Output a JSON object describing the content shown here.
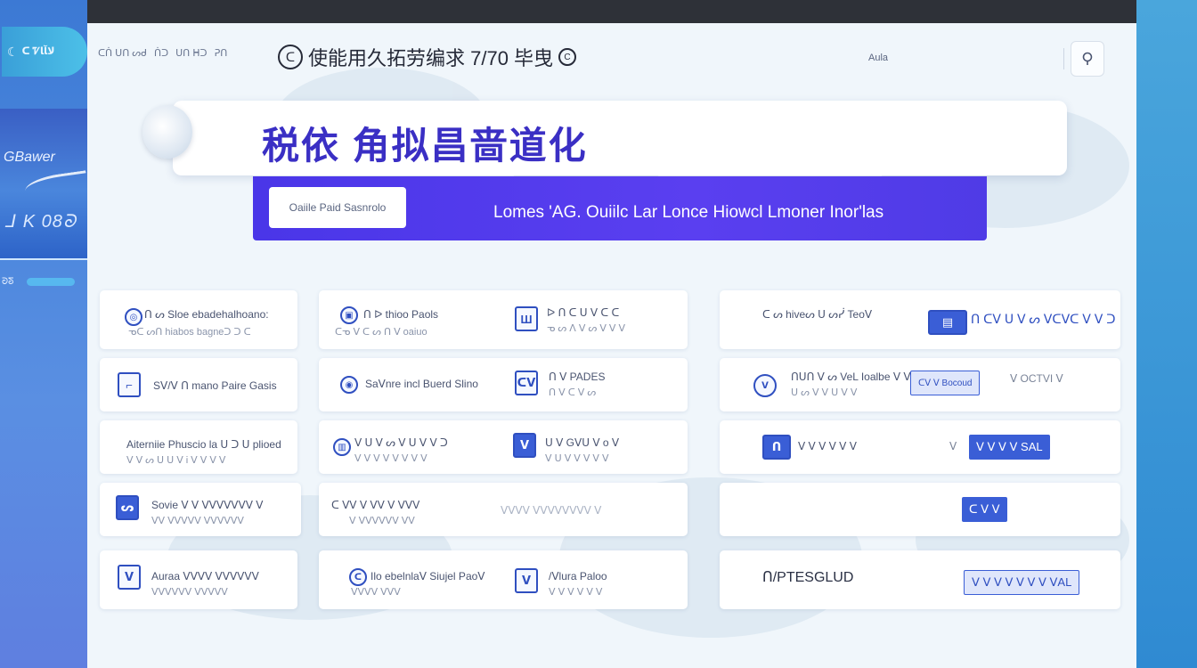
{
  "window": {
    "rail_logo_text": "ᑕ Ꮴﻻﺂﺎ",
    "rail_brand": "GBawer",
    "rail_metric": "ᒧ K 08ᘐ",
    "rail_tag": "ᘐᘕ",
    "user_label": "Aula"
  },
  "header": {
    "nav": [
      "ᑕᑏ ᑌᑎ ᔕᑯ",
      "ᑏᑐ",
      "ᑌᑎ ᕼᑐ",
      "ᕈᑎ"
    ],
    "brand_mark": "ᑕ",
    "brand_text": "使能用久拓劳编求 7/70 毕曳",
    "brand_end": "C"
  },
  "hero": {
    "title": "税依 角拟昌啬道化"
  },
  "banner": {
    "button_label": "Oaiile Paid Sasnrolo",
    "text": "Lomes  'AG. Ouiilc Lar Lonce  Hiowcl Lmoner Inor'las"
  },
  "cards": [
    {
      "icon": "◎",
      "line1": "ᑎ ᔕ Sloe ebadehalhoano:",
      "line2": "ᓀᑕ ᔕᑎ hiabos bagneᑐ ᑐ ᑕ"
    },
    {
      "icon": "▣",
      "line1": "ᑎ ᐅ thioo Paols",
      "line2": "ᑕᓀ ᐯ ᑕ ᔕ ᑎ ᐯ oaiuo"
    },
    {
      "icon": "Ш",
      "line1": "ᐅ ᑎ ᑕ ᑌ ᐯ ᑕ ᑕ",
      "line2": "ᓀ ᔕ ᐱ ᐯ ᔕ ᐯ ᐯ ᐯ"
    },
    {
      "icon": "O",
      "line1": "ᑕ ᔕ hiveᔕ ᑌ ᔕᓰ Teoᐯ",
      "line2": ""
    },
    {
      "icon": "▤",
      "line1": "ᑎ ᑕᐯ ᑌ ᐯ ᔕ ᐯᑕᐯᑕ ᐯ ᐯ ᑐ",
      "line2": ""
    },
    {
      "icon": "⌐",
      "line1": "Sᐯ/ᐯ ᑎ mano Paire Gasis",
      "line2": ""
    },
    {
      "icon": "◉",
      "line1": "Saᐯnre incl Buerd Slino",
      "line2": ""
    },
    {
      "icon": "ᑕᐯ",
      "line1": "ᑎ ᐯ PADES",
      "line2": "ᑎ ᐯ ᑕ ᐯ ᔕ"
    },
    {
      "icon": "ᐯ",
      "line1": "ᑎᑌᑎ ᐯ ᔕ VeL Ioalbe ᐯ ᐯ",
      "line2": "ᑌ ᔕ ᐯ ᐯ ᑌ ᐯ ᐯ"
    },
    {
      "badge": "ᑕᐯ ᐯ Bocoud",
      "side": "ᐯ OCTVI ᐯ"
    },
    {
      "icon": "",
      "line1": "Aiterniie Phuscio la ᑌ ᑐ ᑌ plioed",
      "line2": "ᐯ ᐯ ᔕ ᑌ ᑌ ᐯ Ꭵ ᐯ ᐯ ᐯ ᐯ"
    },
    {
      "icon": "▥",
      "line1": "ᐯ ᑌ ᐯ ᔕ ᐯ ᑌ ᐯ ᐯ ᑐ",
      "line2": "ᐯ ᐯ ᐯ ᐯ ᐯ ᐯ ᐯ ᐯ"
    },
    {
      "icon": "ᐯ",
      "line1": "ᑌ ᐯ Gᐯᑌ ᐯ o ᐯ",
      "line2": "ᐯ ᑌ ᐯ ᐯ ᐯ ᐯ ᐯ"
    },
    {
      "icon": "ᑎ",
      "line1": "ᐯ ᐯ ᐯ ᐯ ᐯ ᐯ",
      "line2": ""
    },
    {
      "badge": "ᐯ ᐯ ᐯ ᐯ SAL",
      "side": "ᐯ"
    },
    {
      "icon": "ᔕ",
      "line1": "Sovie ᐯ ᐯ ᐯᐯᐯᐯᐯᐯᐯ ᐯ",
      "line2": "ᐯᐯ ᐯᐯᐯᐯᐯ ᐯᐯᐯᐯᐯᐯ"
    },
    {
      "icon": "",
      "line1": "ᑕ ᐯᐯ ᐯ ᐯᐯ ᐯ ᐯᐯᐯ",
      "line2": "ᐯ ᐯᐯᐯᐯᐯᐯ ᐯᐯ"
    },
    {
      "icon": "",
      "line1": "ᐯᐯᐯᐯ ᐯᐯᐯᐯᐯᐯᐯᐯ ᐯ",
      "line2": ""
    },
    {
      "badge": "ᑕ ᐯ ᐯ",
      "side": ""
    },
    {
      "icon": "ᐯ",
      "line1": "Auraa ᐯᐯᐯᐯ ᐯᐯᐯᐯᐯᐯ",
      "line2": "ᐯᐯᐯᐯᐯᐯ ᐯᐯᐯᐯᐯ"
    },
    {
      "icon": "ᑕ",
      "line1": "Ilo ebelnlaᐯ Siujel Paoᐯ",
      "line2": "ᐯᐯᐯᐯ ᐯᐯᐯ"
    },
    {
      "icon": "ᐯ",
      "line1": "/ᐯlura Paloo",
      "line2": "ᐯ ᐯ ᐯ ᐯ ᐯ ᐯ"
    },
    {
      "line1": "ᑎ/PTESGLUD",
      "line2": ""
    },
    {
      "badge": "ᐯ ᐯ ᐯ ᐯ ᐯ ᐯ ᐯ ᐯAL",
      "side": ""
    }
  ],
  "colors": {
    "accent": "#4a36e8",
    "primary_blue": "#3a5ed6",
    "title_purple": "#3a2fc4"
  }
}
